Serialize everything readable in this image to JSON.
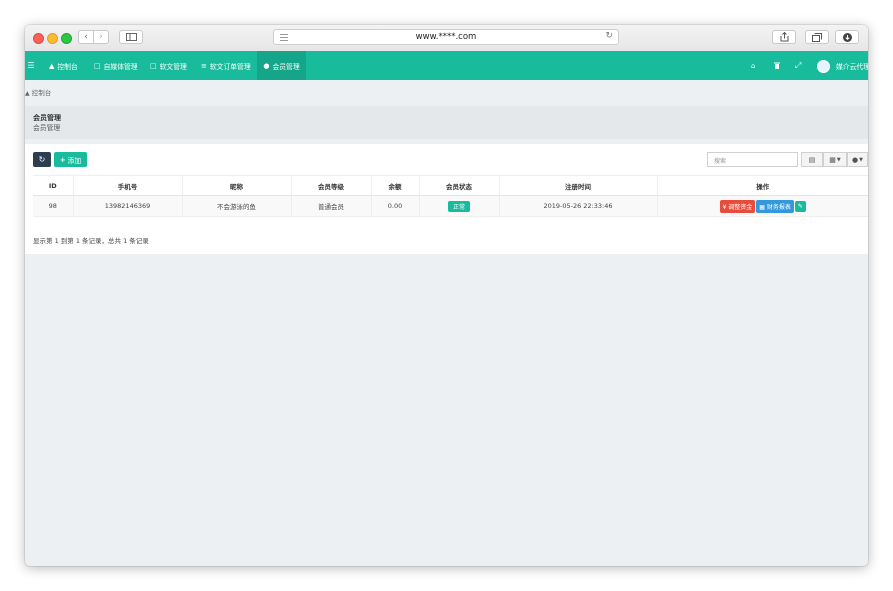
{
  "browser": {
    "url": "www.****.com"
  },
  "navbar": {
    "menu_icon": "menu-icon",
    "items": [
      {
        "label": "控制台",
        "icon": "dashboard-icon"
      },
      {
        "label": "自媒体管理",
        "icon": "file-icon"
      },
      {
        "label": "软文管理",
        "icon": "file-icon"
      },
      {
        "label": "软文订单管理",
        "icon": "list-icon"
      },
      {
        "label": "会员管理",
        "icon": "user-icon",
        "active": true
      }
    ],
    "right_icons": [
      "home-icon",
      "trash-icon",
      "fullscreen-icon"
    ],
    "username": "媒介云代理",
    "accent": "#18bc9c"
  },
  "breadcrumb": {
    "label": "控制台"
  },
  "page": {
    "title": "会员管理",
    "subtitle": "会员管理"
  },
  "toolbar": {
    "refresh_icon": "refresh-icon",
    "add_label": "添加",
    "search_placeholder": "搜索"
  },
  "table": {
    "columns": [
      "ID",
      "手机号",
      "昵称",
      "会员等级",
      "余额",
      "会员状态",
      "注册时间",
      "操作"
    ],
    "rows": [
      {
        "id": "98",
        "phone": "13982146369",
        "nickname": "不会游泳的鱼",
        "level": "普通会员",
        "balance": "0.00",
        "status": "正常",
        "registered": "2019-05-26 22:33:46",
        "actions": {
          "adjust": "¥ 调整资金",
          "report": "财务报表"
        }
      }
    ]
  },
  "pagination": {
    "info": "显示第 1 到第 1 条记录，总共 1 条记录"
  },
  "colors": {
    "primary": "#18bc9c",
    "danger": "#e74c3c",
    "info": "#3498db",
    "dark": "#2c3e50"
  }
}
